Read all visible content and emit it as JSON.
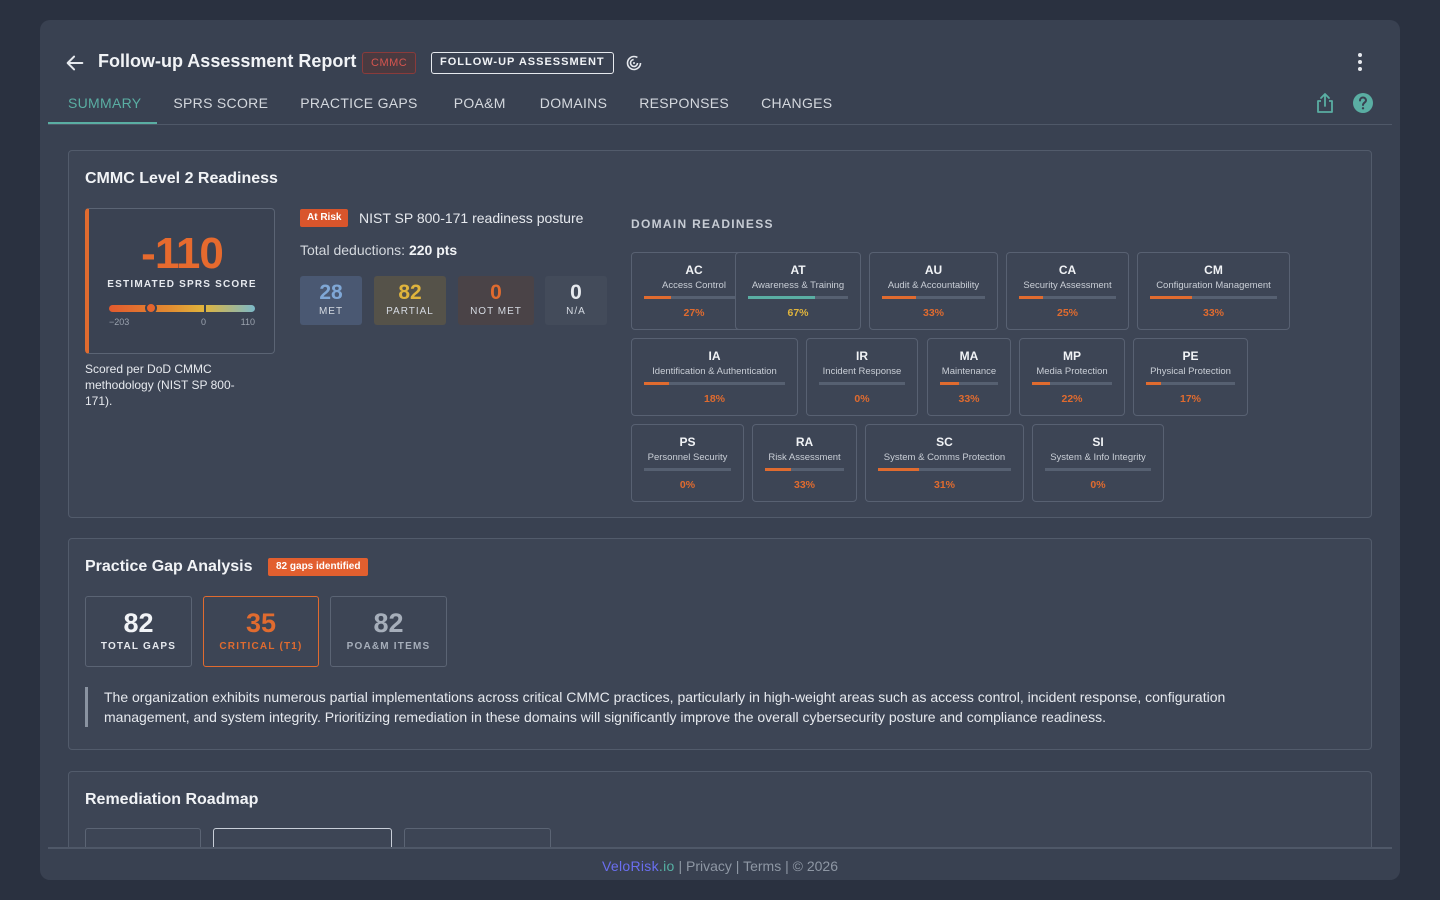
{
  "header": {
    "title": "Follow-up Assessment Report",
    "badge_framework": "CMMC",
    "badge_type": "FOLLOW-UP ASSESSMENT"
  },
  "tabs": [
    "SUMMARY",
    "SPRS SCORE",
    "PRACTICE GAPS",
    "POA&M",
    "DOMAINS",
    "RESPONSES",
    "CHANGES"
  ],
  "active_tab": "SUMMARY",
  "readiness": {
    "title": "CMMC Level 2 Readiness",
    "score": "-110",
    "score_label": "ESTIMATED SPRS SCORE",
    "scale_min": "−203",
    "scale_mid": "0",
    "scale_max": "110",
    "score_note": "Scored per DoD CMMC methodology (NIST SP 800-171).",
    "risk_badge": "At Risk",
    "posture": "NIST SP 800-171 readiness posture",
    "deductions_label": "Total deductions:",
    "deductions_value": "220 pts",
    "stats": [
      {
        "value": "28",
        "label": "MET",
        "color": "#7fa7d6"
      },
      {
        "value": "82",
        "label": "PARTIAL",
        "color": "#e0b43c"
      },
      {
        "value": "0",
        "label": "NOT MET",
        "color": "#e06b2f"
      },
      {
        "value": "0",
        "label": "N/A",
        "color": "#e6e9ee"
      }
    ]
  },
  "domain_readiness": {
    "title": "DOMAIN READINESS",
    "domains": [
      {
        "code": "AC",
        "name": "Access Control",
        "pct": "27%",
        "value": 0.27
      },
      {
        "code": "AT",
        "name": "Awareness & Training",
        "pct": "67%",
        "value": 0.67
      },
      {
        "code": "AU",
        "name": "Audit & Accountability",
        "pct": "33%",
        "value": 0.33
      },
      {
        "code": "CA",
        "name": "Security Assessment",
        "pct": "25%",
        "value": 0.25
      },
      {
        "code": "CM",
        "name": "Configuration Management",
        "pct": "33%",
        "value": 0.33
      },
      {
        "code": "IA",
        "name": "Identification & Authentication",
        "pct": "18%",
        "value": 0.18
      },
      {
        "code": "IR",
        "name": "Incident Response",
        "pct": "0%",
        "value": 0
      },
      {
        "code": "MA",
        "name": "Maintenance",
        "pct": "33%",
        "value": 0.33
      },
      {
        "code": "MP",
        "name": "Media Protection",
        "pct": "22%",
        "value": 0.22
      },
      {
        "code": "PE",
        "name": "Physical Protection",
        "pct": "17%",
        "value": 0.17
      },
      {
        "code": "PS",
        "name": "Personnel Security",
        "pct": "0%",
        "value": 0
      },
      {
        "code": "RA",
        "name": "Risk Assessment",
        "pct": "33%",
        "value": 0.33
      },
      {
        "code": "SC",
        "name": "System & Comms Protection",
        "pct": "31%",
        "value": 0.31
      },
      {
        "code": "SI",
        "name": "System & Info Integrity",
        "pct": "0%",
        "value": 0
      }
    ]
  },
  "gaps": {
    "title": "Practice Gap Analysis",
    "badge": "82 gaps identified",
    "stats": [
      {
        "value": "82",
        "label": "TOTAL GAPS"
      },
      {
        "value": "35",
        "label": "CRITICAL (T1)"
      },
      {
        "value": "82",
        "label": "POA&M ITEMS"
      }
    ],
    "summary": "The organization exhibits numerous partial implementations across critical CMMC practices, particularly in high-weight areas such as access control, incident response, configuration management, and system integrity. Prioritizing remediation in these domains will significantly improve the overall cybersecurity posture and compliance readiness."
  },
  "roadmap": {
    "title": "Remediation Roadmap"
  },
  "footer": {
    "brand_main": "VeloRisk",
    "brand_tld": ".io",
    "privacy": "Privacy",
    "terms": "Terms",
    "copyright": "© 2026",
    "sep": "|"
  },
  "colors": {
    "accent": "#5aaea3",
    "warning": "#e06b2f",
    "partial": "#e0b43c",
    "met": "#7fa7d6"
  }
}
